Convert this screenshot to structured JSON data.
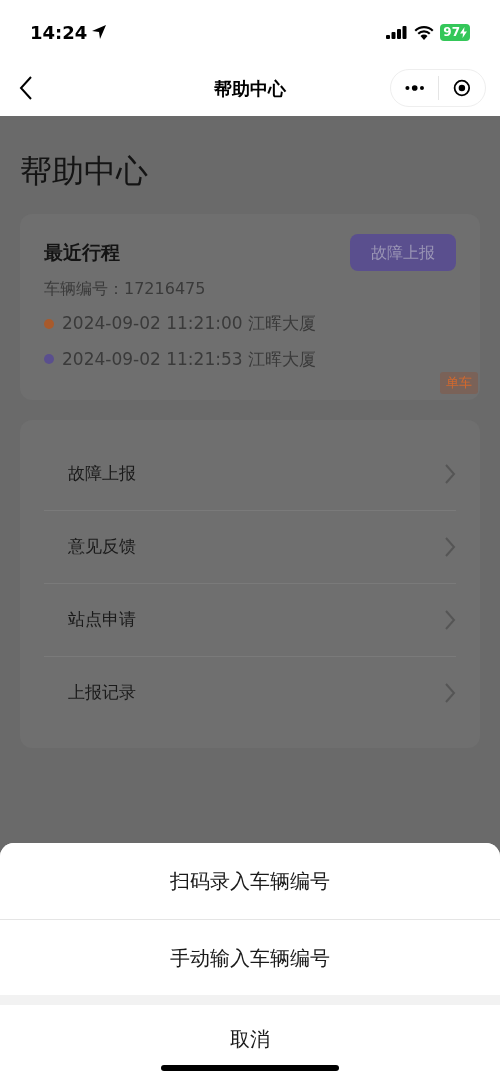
{
  "status_bar": {
    "time": "14:24",
    "battery": "97"
  },
  "nav_bar": {
    "title": "帮助中心"
  },
  "page": {
    "heading": "帮助中心",
    "recent_trip": {
      "title": "最近行程",
      "report_button": "故障上报",
      "vehicle_number": "车辆编号：17216475",
      "tag": "单车",
      "stops": [
        {
          "text": "2024-09-02 11:21:00 江晖大厦",
          "color": "#a85a2c"
        },
        {
          "text": "2024-09-02 11:21:53 江晖大厦",
          "color": "#5a4f8e"
        }
      ]
    },
    "menu": [
      "故障上报",
      "意见反馈",
      "站点申请",
      "上报记录"
    ]
  },
  "action_sheet": {
    "options": [
      "扫码录入车辆编号",
      "手动输入车辆编号"
    ],
    "cancel": "取消"
  }
}
